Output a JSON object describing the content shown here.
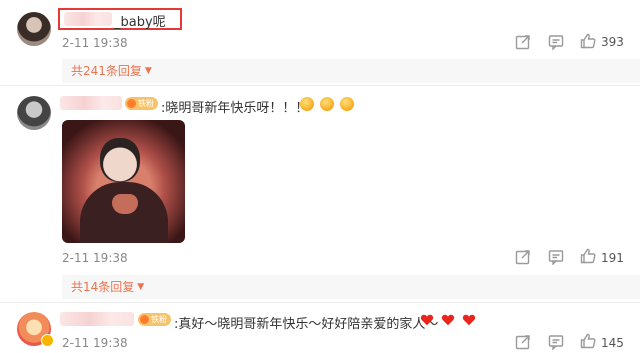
{
  "comments": [
    {
      "username_suffix": "_baby呢",
      "time": "2-11 19:38",
      "likes": "393",
      "replies_label": "共241条回复"
    },
    {
      "text": ":晓明哥新年快乐呀！！！",
      "badge": "铁粉",
      "time": "2-11 19:38",
      "likes": "191",
      "replies_label": "共14条回复"
    },
    {
      "text": ":真好～晓明哥新年快乐～好好陪亲爱的家人～",
      "badge": "铁粉",
      "time": "2-11 19:38",
      "likes": "145"
    }
  ],
  "colors": {
    "accent_orange": "#eb7350",
    "highlight_box": "#e53935",
    "heart_red": "#e8261d",
    "badge_bg": "#f6c36a"
  },
  "icons": [
    "share-icon",
    "comment-icon",
    "thumbs-up-icon",
    "heart-emoji",
    "smiling-face-emoji"
  ]
}
